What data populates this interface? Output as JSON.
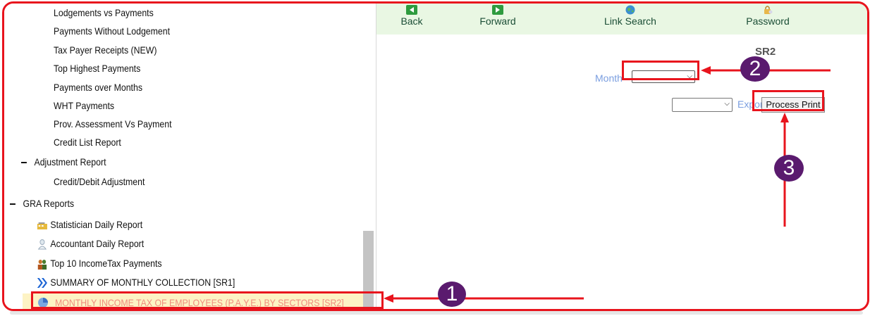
{
  "tree": {
    "items": [
      {
        "label": "Lodgements vs Payments"
      },
      {
        "label": "Payments Without Lodgement"
      },
      {
        "label": "Tax Payer Receipts (NEW)"
      },
      {
        "label": "Top Highest Payments"
      },
      {
        "label": "Payments over Months"
      },
      {
        "label": "WHT Payments"
      },
      {
        "label": "Prov. Assessment Vs Payment"
      },
      {
        "label": "Credit List Report"
      }
    ],
    "adjustment_group": "Adjustment Report",
    "adjustment_item": "Credit/Debit Adjustment",
    "gra_group": "GRA Reports",
    "gra_items": [
      {
        "label": "Statistician Daily Report",
        "icon": "calculator-icon"
      },
      {
        "label": "Accountant Daily Report",
        "icon": "accountant-icon"
      },
      {
        "label": "Top 10 IncomeTax Payments",
        "icon": "people-icon"
      },
      {
        "label": "SUMMARY OF MONTHLY COLLECTION [SR1]",
        "icon": "double-chevron-icon"
      }
    ],
    "selected_item": "MONTHLY INCOME TAX OF EMPLOYEES (P.A.Y.E.) BY SECTORS [SR2]"
  },
  "toolbar": {
    "back": "Back",
    "forward": "Forward",
    "link_search": "Link Search",
    "password": "Password"
  },
  "form": {
    "report_code": "SR2",
    "month_label": "Month",
    "month_value": "",
    "export_value": "",
    "export_label": "Export",
    "process_print": "Process Print"
  },
  "annotations": {
    "step1": "1",
    "step2": "2",
    "step3": "3"
  },
  "colors": {
    "annotation_red": "#e8141d",
    "badge_purple": "#5a1a6e",
    "toolbar_bg": "#e9f7e3",
    "label_blue": "#7a9ee0"
  }
}
